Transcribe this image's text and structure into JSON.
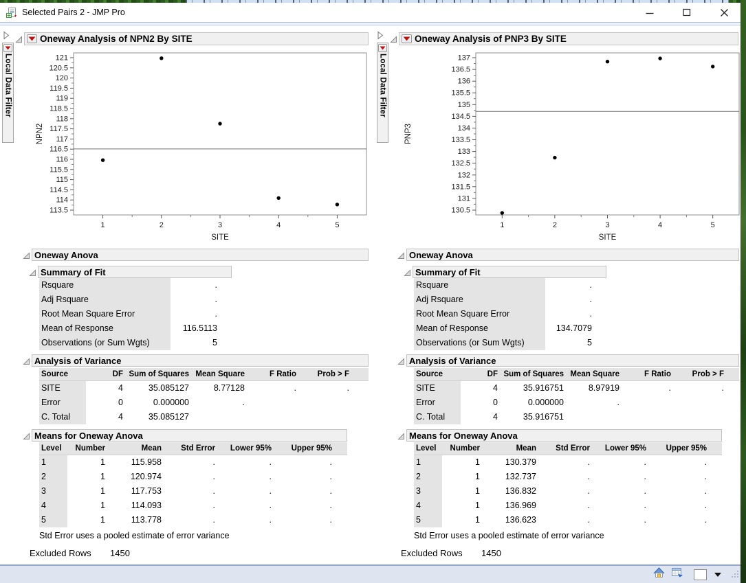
{
  "window": {
    "title": "Selected Pairs 2 - JMP Pro",
    "controls": [
      "minimize",
      "maximize",
      "close"
    ]
  },
  "status_bar": {
    "icons": [
      "home-icon",
      "data-table-icon",
      "panel-box",
      "dropdown-arrow",
      "resize-grip"
    ]
  },
  "panels": [
    {
      "title": "Oneway Analysis of NPN2 By SITE",
      "local_data_filter": "Local Data Filter",
      "anova_group_title": "Oneway Anova",
      "summary_of_fit": {
        "title": "Summary of Fit",
        "rows": [
          [
            "Rsquare",
            "."
          ],
          [
            "Adj Rsquare",
            "."
          ],
          [
            "Root Mean Square Error",
            "."
          ],
          [
            "Mean of Response",
            "116.5113"
          ],
          [
            "Observations (or Sum Wgts)",
            "5"
          ]
        ]
      },
      "anova": {
        "title": "Analysis of Variance",
        "columns": [
          "Source",
          "DF",
          "Sum of Squares",
          "Mean Square",
          "F Ratio",
          "Prob > F"
        ],
        "rows": [
          [
            "SITE",
            "4",
            "35.085127",
            "8.77128",
            ".",
            "."
          ],
          [
            "Error",
            "0",
            "0.000000",
            ".",
            "",
            ""
          ],
          [
            "C. Total",
            "4",
            "35.085127",
            "",
            "",
            ""
          ]
        ]
      },
      "means": {
        "title": "Means for Oneway Anova",
        "columns": [
          "Level",
          "Number",
          "Mean",
          "Std Error",
          "Lower 95%",
          "Upper 95%"
        ],
        "rows": [
          [
            "1",
            "1",
            "115.958",
            ".",
            ".",
            "."
          ],
          [
            "2",
            "1",
            "120.974",
            ".",
            ".",
            "."
          ],
          [
            "3",
            "1",
            "117.753",
            ".",
            ".",
            "."
          ],
          [
            "4",
            "1",
            "114.093",
            ".",
            ".",
            "."
          ],
          [
            "5",
            "1",
            "113.778",
            ".",
            ".",
            "."
          ]
        ]
      },
      "footnote": "Std Error uses a pooled estimate of error variance",
      "excluded": {
        "label": "Excluded Rows",
        "value": "1450"
      }
    },
    {
      "title": "Oneway Analysis of PNP3 By SITE",
      "local_data_filter": "Local Data Filter",
      "anova_group_title": "Oneway Anova",
      "summary_of_fit": {
        "title": "Summary of Fit",
        "rows": [
          [
            "Rsquare",
            "."
          ],
          [
            "Adj Rsquare",
            "."
          ],
          [
            "Root Mean Square Error",
            "."
          ],
          [
            "Mean of Response",
            "134.7079"
          ],
          [
            "Observations (or Sum Wgts)",
            "5"
          ]
        ]
      },
      "anova": {
        "title": "Analysis of Variance",
        "columns": [
          "Source",
          "DF",
          "Sum of Squares",
          "Mean Square",
          "F Ratio",
          "Prob > F"
        ],
        "rows": [
          [
            "SITE",
            "4",
            "35.916751",
            "8.97919",
            ".",
            "."
          ],
          [
            "Error",
            "0",
            "0.000000",
            ".",
            "",
            ""
          ],
          [
            "C. Total",
            "4",
            "35.916751",
            "",
            "",
            ""
          ]
        ]
      },
      "means": {
        "title": "Means for Oneway Anova",
        "columns": [
          "Level",
          "Number",
          "Mean",
          "Std Error",
          "Lower 95%",
          "Upper 95%"
        ],
        "rows": [
          [
            "1",
            "1",
            "130.379",
            ".",
            ".",
            "."
          ],
          [
            "2",
            "1",
            "132.737",
            ".",
            ".",
            "."
          ],
          [
            "3",
            "1",
            "136.832",
            ".",
            ".",
            "."
          ],
          [
            "4",
            "1",
            "136.969",
            ".",
            ".",
            "."
          ],
          [
            "5",
            "1",
            "136.623",
            ".",
            ".",
            "."
          ]
        ]
      },
      "footnote": "Std Error uses a pooled estimate of error variance",
      "excluded": {
        "label": "Excluded Rows",
        "value": "1450"
      }
    }
  ],
  "chart_data": [
    {
      "type": "scatter",
      "title": "Oneway Analysis of NPN2 By SITE",
      "xlabel": "SITE",
      "ylabel": "NPN2",
      "x": [
        1,
        2,
        3,
        4,
        5
      ],
      "x_ticks": [
        "1",
        "2",
        "3",
        "4",
        "5"
      ],
      "y": [
        115.958,
        120.974,
        117.753,
        114.093,
        113.778
      ],
      "mean_line": 116.5113,
      "ylim": [
        113.5,
        121
      ],
      "y_ticks": [
        "121",
        "120.5",
        "120",
        "119.5",
        "119",
        "118.5",
        "118",
        "117.5",
        "117",
        "116.5",
        "116",
        "115.5",
        "115",
        "114.5",
        "114",
        "113.5"
      ],
      "grid": false,
      "legend": "none"
    },
    {
      "type": "scatter",
      "title": "Oneway Analysis of PNP3 By SITE",
      "xlabel": "SITE",
      "ylabel": "PNP3",
      "x": [
        1,
        2,
        3,
        4,
        5
      ],
      "x_ticks": [
        "1",
        "2",
        "3",
        "4",
        "5"
      ],
      "y": [
        130.379,
        132.737,
        136.832,
        136.969,
        136.623
      ],
      "mean_line": 134.7079,
      "ylim": [
        130.5,
        137
      ],
      "y_ticks": [
        "137",
        "136.5",
        "136",
        "135.5",
        "135",
        "134.5",
        "134",
        "133.5",
        "133",
        "132.5",
        "132",
        "131.5",
        "131",
        "130.5"
      ],
      "grid": false,
      "legend": "none"
    }
  ]
}
